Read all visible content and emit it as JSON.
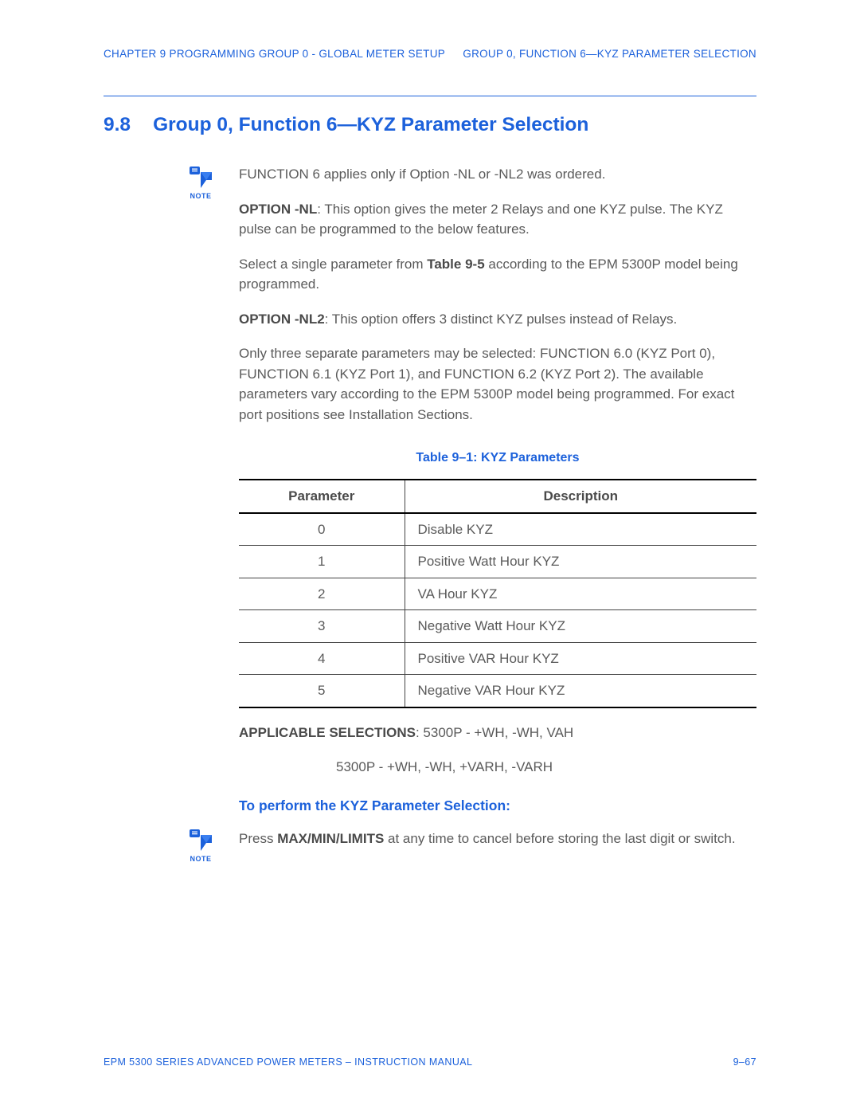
{
  "header": {
    "left": "CHAPTER 9  PROGRAMMING GROUP 0 - GLOBAL METER SETUP",
    "right": "GROUP 0, FUNCTION 6—KYZ PARAMETER SELECTION"
  },
  "section": {
    "number": "9.8",
    "title": "Group 0, Function 6—KYZ Parameter Selection"
  },
  "note_label": "NOTE",
  "p1": "FUNCTION 6 applies only if Option -NL or -NL2 was ordered.",
  "p2_bold": "OPTION -NL",
  "p2_rest": ": This option gives the meter 2 Relays and one KYZ pulse.  The KYZ pulse can be programmed to the below features.",
  "p3a": "Select a single parameter from ",
  "p3_bold": "Table 9-5",
  "p3b": " according to the EPM 5300P model being programmed.",
  "p4_bold": "OPTION -NL2",
  "p4_rest": ": This option offers 3 distinct KYZ pulses instead of Relays.",
  "p5": "Only three separate parameters may be selected:  FUNCTION 6.0 (KYZ Port 0), FUNCTION 6.1 (KYZ Port 1), and FUNCTION 6.2 (KYZ Port 2). The available parameters vary according to the EPM 5300P model being programmed. For exact port positions see Installation Sections.",
  "table": {
    "caption": "Table 9–1: KYZ Parameters",
    "head_param": "Parameter",
    "head_desc": "Description",
    "rows": [
      {
        "p": "0",
        "d": "Disable KYZ"
      },
      {
        "p": "1",
        "d": "Positive Watt Hour KYZ"
      },
      {
        "p": "2",
        "d": "VA Hour KYZ"
      },
      {
        "p": "3",
        "d": "Negative Watt Hour KYZ"
      },
      {
        "p": "4",
        "d": "Positive VAR Hour KYZ"
      },
      {
        "p": "5",
        "d": "Negative VAR Hour KYZ"
      }
    ]
  },
  "appsel_bold": "APPLICABLE SELECTIONS",
  "appsel_rest": ":  5300P - +WH, -WH, VAH",
  "appsel_line2": "5300P - +WH, -WH, +VARH, -VARH",
  "subhead": "To perform the KYZ Parameter Selection:",
  "p6a": "Press ",
  "p6_bold": "MAX/MIN/LIMITS",
  "p6b": " at any time to cancel before storing the last digit or switch.",
  "footer": {
    "left": "EPM 5300 SERIES ADVANCED POWER METERS – INSTRUCTION MANUAL",
    "right": "9–67"
  }
}
